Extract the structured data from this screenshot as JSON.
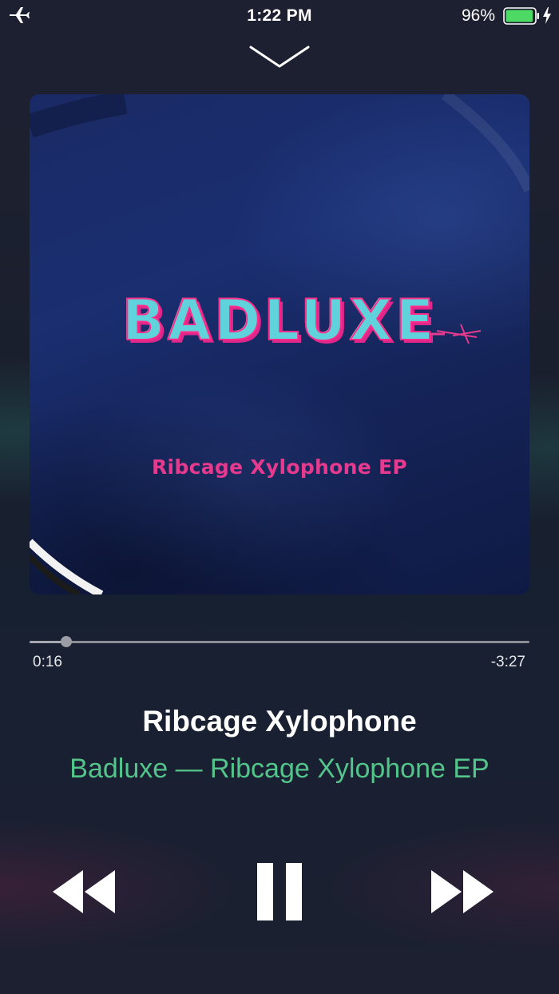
{
  "status_bar": {
    "time": "1:22 PM",
    "battery_percent": "96%",
    "battery_level": 0.96,
    "icons": [
      "airplane-icon",
      "battery-icon",
      "charging-bolt-icon"
    ]
  },
  "header": {
    "dismiss_icon": "chevron-down-icon"
  },
  "artwork": {
    "logo_text": "BADLUXE",
    "subtitle": "Ribcage Xylophone EP"
  },
  "playback": {
    "elapsed": "0:16",
    "remaining": "-3:27",
    "progress_fraction": 0.073
  },
  "track": {
    "title": "Ribcage Xylophone",
    "subtitle": "Badluxe — Ribcage Xylophone EP"
  },
  "controls": {
    "rewind_icon": "rewind-icon",
    "pause_icon": "pause-icon",
    "forward_icon": "fast-forward-icon"
  },
  "colors": {
    "accent": "#53c48a",
    "battery_fill": "#4cd964",
    "logo_cyan": "#5fd2dc",
    "logo_pink": "#ff2d8a"
  }
}
